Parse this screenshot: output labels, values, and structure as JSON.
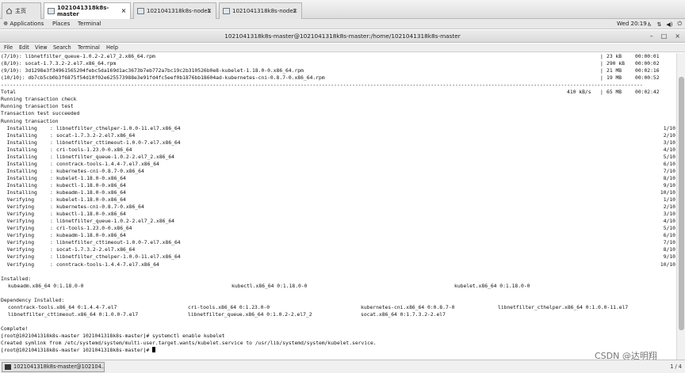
{
  "tabs": [
    {
      "label": "主页",
      "icon": "home-icon"
    },
    {
      "label": "1021041318k8s-master",
      "icon": "vm-icon"
    },
    {
      "label": "1021041318k8s-node1",
      "icon": "vm-icon"
    },
    {
      "label": "1021041318k8s-node2",
      "icon": "vm-icon"
    }
  ],
  "gnome_panel": {
    "applications": "Applications",
    "places": "Places",
    "terminal": "Terminal",
    "clock": "Wed 20:19"
  },
  "window": {
    "title": "1021041318k8s-master@1021041318k8s-master:/home/1021041318k8s-master"
  },
  "menu": [
    "File",
    "Edit",
    "View",
    "Search",
    "Terminal",
    "Help"
  ],
  "download_rows": [
    {
      "text": "(7/10): libnetfilter_queue-1.0.2-2.el7_2.x86_64.rpm",
      "size": "23 kB",
      "time": "00:00:01"
    },
    {
      "text": "(8/10): socat-1.7.3.2-2.el7.x86_64.rpm",
      "size": "290 kB",
      "time": "00:00:02"
    },
    {
      "text": "(9/10): 3d1298e3f34961565204febc5da169d1ac3673b7eb772a7bc19c2b310526b0e8-kubelet-1.18.0-0.x86_64.rpm",
      "size": "21 MB",
      "time": "00:02:16"
    },
    {
      "text": "(10/10): db7cb5cb0b3f6875f54d10f02e625573988e3e91fd4fc5eef0b1876bb18604ad-kubernetes-cni-0.8.7-0.x86_64.rpm",
      "size": "19 MB",
      "time": "00:00:52"
    }
  ],
  "separator": "--------------------------------------------------------------------------------------------------------------------------------------------------------------------------------------------------------------------",
  "total": {
    "label": "Total",
    "rate": "410 kB/s",
    "size": "65 MB",
    "time": "00:02:42"
  },
  "transaction_lines": [
    "Running transaction check",
    "Running transaction test",
    "Transaction test succeeded",
    "Running transaction"
  ],
  "steps": [
    {
      "action": "  Installing",
      "pkg": "libnetfilter_cthelper-1.0.0-11.el7.x86_64",
      "n": "1/10"
    },
    {
      "action": "  Installing",
      "pkg": "socat-1.7.3.2-2.el7.x86_64",
      "n": "2/10"
    },
    {
      "action": "  Installing",
      "pkg": "libnetfilter_cttimeout-1.0.0-7.el7.x86_64",
      "n": "3/10"
    },
    {
      "action": "  Installing",
      "pkg": "cri-tools-1.23.0-0.x86_64",
      "n": "4/10"
    },
    {
      "action": "  Installing",
      "pkg": "libnetfilter_queue-1.0.2-2.el7_2.x86_64",
      "n": "5/10"
    },
    {
      "action": "  Installing",
      "pkg": "conntrack-tools-1.4.4-7.el7.x86_64",
      "n": "6/10"
    },
    {
      "action": "  Installing",
      "pkg": "kubernetes-cni-0.8.7-0.x86_64",
      "n": "7/10"
    },
    {
      "action": "  Installing",
      "pkg": "kubelet-1.18.0-0.x86_64",
      "n": "8/10"
    },
    {
      "action": "  Installing",
      "pkg": "kubectl-1.18.0-0.x86_64",
      "n": "9/10"
    },
    {
      "action": "  Installing",
      "pkg": "kubeadm-1.18.0-0.x86_64",
      "n": "10/10"
    },
    {
      "action": "  Verifying ",
      "pkg": "kubelet-1.18.0-0.x86_64",
      "n": "1/10"
    },
    {
      "action": "  Verifying ",
      "pkg": "kubernetes-cni-0.8.7-0.x86_64",
      "n": "2/10"
    },
    {
      "action": "  Verifying ",
      "pkg": "kubectl-1.18.0-0.x86_64",
      "n": "3/10"
    },
    {
      "action": "  Verifying ",
      "pkg": "libnetfilter_queue-1.0.2-2.el7_2.x86_64",
      "n": "4/10"
    },
    {
      "action": "  Verifying ",
      "pkg": "cri-tools-1.23.0-0.x86_64",
      "n": "5/10"
    },
    {
      "action": "  Verifying ",
      "pkg": "kubeadm-1.18.0-0.x86_64",
      "n": "6/10"
    },
    {
      "action": "  Verifying ",
      "pkg": "libnetfilter_cttimeout-1.0.0-7.el7.x86_64",
      "n": "7/10"
    },
    {
      "action": "  Verifying ",
      "pkg": "socat-1.7.3.2-2.el7.x86_64",
      "n": "8/10"
    },
    {
      "action": "  Verifying ",
      "pkg": "libnetfilter_cthelper-1.0.0-11.el7.x86_64",
      "n": "9/10"
    },
    {
      "action": "  Verifying ",
      "pkg": "conntrack-tools-1.4.4-7.el7.x86_64",
      "n": "10/10"
    }
  ],
  "installed_label": "Installed:",
  "installed": [
    "kubeadm.x86_64 0:1.18.0-0",
    "kubectl.x86_64 0:1.18.0-0",
    "kubelet.x86_64 0:1.18.0-0"
  ],
  "dependency_label": "Dependency Installed:",
  "dependencies_row1": [
    "conntrack-tools.x86_64 0:1.4.4-7.el7",
    "cri-tools.x86_64 0:1.23.0-0",
    "kubernetes-cni.x86_64 0:0.8.7-0",
    "libnetfilter_cthelper.x86_64 0:1.0.0-11.el7"
  ],
  "dependencies_row2": [
    "libnetfilter_cttimeout.x86_64 0:1.0.0-7.el7",
    "libnetfilter_queue.x86_64 0:1.0.2-2.el7_2",
    "socat.x86_64 0:1.7.3.2-2.el7"
  ],
  "complete": "Complete!",
  "cmd_line": "[root@1021041318k8s-master 1021041318k8s-master]# systemctl enable kubelet",
  "symlink_line": "Created symlink from /etc/systemd/system/multi-user.target.wants/kubelet.service to /usr/lib/systemd/system/kubelet.service.",
  "prompt_line": "[root@1021041318k8s-master 1021041318k8s-master]# ",
  "taskbar": {
    "button": "1021041318k8s-master@102104...",
    "pager": "1 / 4"
  },
  "watermark": "CSDN @达明翔"
}
